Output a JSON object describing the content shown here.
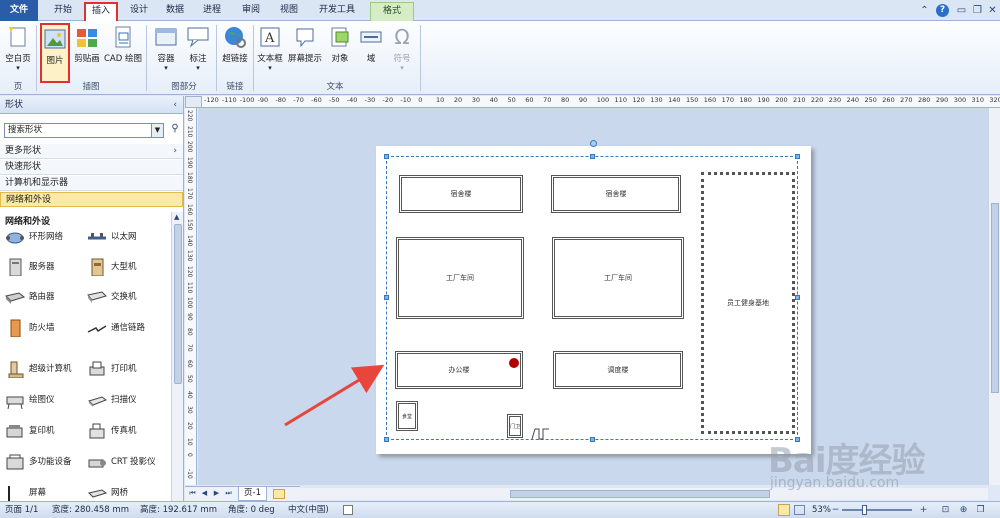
{
  "tabs": [
    {
      "label": "文件"
    },
    {
      "label": "开始"
    },
    {
      "label": "插入"
    },
    {
      "label": "设计"
    },
    {
      "label": "数据"
    },
    {
      "label": "进程"
    },
    {
      "label": "审阅"
    },
    {
      "label": "视图"
    },
    {
      "label": "开发工具"
    },
    {
      "label": "格式"
    }
  ],
  "ribbon": {
    "buttons": {
      "blank_page": "空白页",
      "picture": "图片",
      "clip_art": "剪贴画",
      "cad": "CAD 绘图",
      "container": "容器",
      "callout": "标注",
      "hyperlink": "超链接",
      "textbox": "文本框",
      "screentip": "屏幕提示",
      "object": "对象",
      "field": "域",
      "symbol": "符号"
    },
    "groups": {
      "page": "页",
      "illustrations": "插图",
      "diagram_parts": "图部分",
      "links": "链接",
      "text": "文本"
    }
  },
  "shapes_pane": {
    "title": "形状",
    "search_placeholder": "搜索形状",
    "more_shapes": "更多形状",
    "quick_shapes": "快速形状",
    "computers_monitors": "计算机和显示器",
    "network_peripherals": "网络和外设",
    "stencil_title": "网络和外设",
    "items": [
      {
        "label": "环形网络"
      },
      {
        "label": "以太网"
      },
      {
        "label": "服务器"
      },
      {
        "label": "大型机"
      },
      {
        "label": "路由器"
      },
      {
        "label": "交换机"
      },
      {
        "label": "防火墙"
      },
      {
        "label": "通信链路"
      },
      {
        "label": "超级计算机"
      },
      {
        "label": "打印机"
      },
      {
        "label": "绘图仪"
      },
      {
        "label": "扫描仪"
      },
      {
        "label": "复印机"
      },
      {
        "label": "传真机"
      },
      {
        "label": "多功能设备"
      },
      {
        "label": "CRT 投影仪"
      },
      {
        "label": "屏幕"
      },
      {
        "label": "网桥"
      }
    ]
  },
  "ruler": {
    "h_labels": [
      "-120",
      "-110",
      "-100",
      "-90",
      "-80",
      "-70",
      "-60",
      "-50",
      "-40",
      "-30",
      "-20",
      "-10",
      "0",
      "10",
      "20",
      "30",
      "40",
      "50",
      "60",
      "70",
      "80",
      "90",
      "100",
      "110",
      "120",
      "130",
      "140",
      "150",
      "160",
      "170",
      "180",
      "190",
      "200",
      "210",
      "220",
      "230",
      "240",
      "250",
      "260",
      "270",
      "280",
      "290",
      "300",
      "310",
      "320",
      "330",
      "340"
    ],
    "v_labels": [
      "220",
      "210",
      "200",
      "190",
      "180",
      "170",
      "160",
      "150",
      "140",
      "130",
      "120",
      "110",
      "100",
      "90",
      "80",
      "70",
      "60",
      "50",
      "40",
      "30",
      "20",
      "10",
      "0",
      "-10"
    ]
  },
  "drawing": {
    "buildings": {
      "dorm1": "宿舍楼",
      "dorm2": "宿舍楼",
      "workshop1": "工厂车间",
      "workshop2": "工厂车间",
      "fitness": "员工健身基地",
      "office": "办公楼",
      "dispatch": "调度楼",
      "canteen": "食堂",
      "gate": "门卫"
    }
  },
  "page_tabs": {
    "current": "页-1"
  },
  "status": {
    "page": "页面 1/1",
    "width": "宽度: 280.458 mm",
    "height": "高度: 192.617 mm",
    "angle": "角度: 0 deg",
    "language": "中文(中国)",
    "zoom": "53%"
  },
  "watermark": {
    "brand": "Bai度经验",
    "url": "jingyan.baidu.com"
  },
  "colors": {
    "accent": "#2a5ca8",
    "highlight_border": "#e03030",
    "selected_category": "#fce9a8",
    "red_dot": "#b00000",
    "arrow": "#e8453c"
  }
}
